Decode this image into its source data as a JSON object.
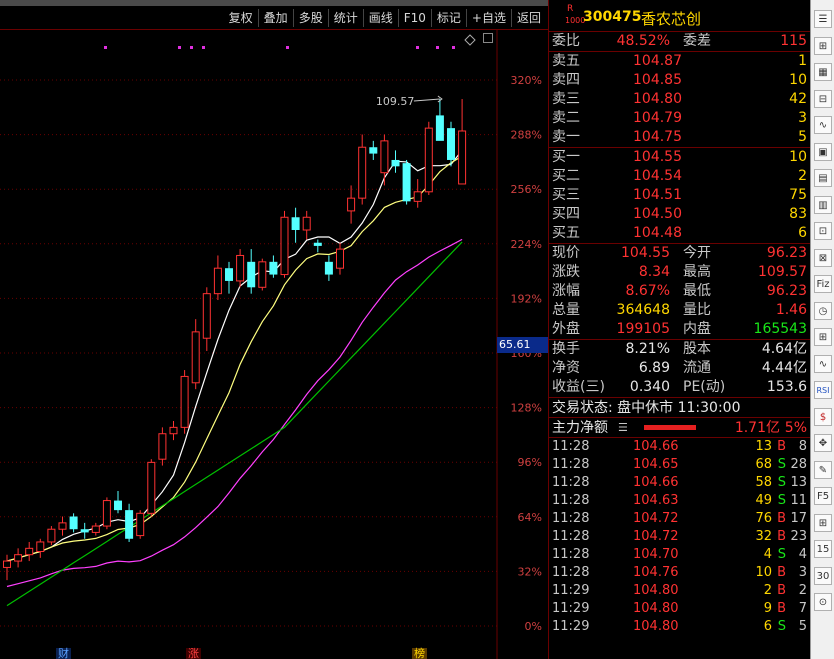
{
  "toolbar": {
    "buttons": [
      "复权",
      "叠加",
      "多股",
      "统计",
      "画线",
      "F10",
      "标记",
      "+自选",
      "返回"
    ]
  },
  "chart_data": {
    "type": "candlestick",
    "pct_axis": [
      "320%",
      "288%",
      "256%",
      "224%",
      "192%",
      "160%",
      "128%",
      "96%",
      "64%",
      "32%",
      "0%"
    ],
    "cursor_price": "65.61",
    "peak_label": "109.57",
    "bottom_marks": [
      "财",
      "涨",
      "榜"
    ],
    "candles": [
      {
        "o": 36,
        "h": 38,
        "l": 34,
        "c": 37
      },
      {
        "o": 37,
        "h": 39,
        "l": 36,
        "c": 38
      },
      {
        "o": 38,
        "h": 40,
        "l": 37,
        "c": 39
      },
      {
        "o": 38.5,
        "h": 40.5,
        "l": 37.5,
        "c": 40
      },
      {
        "o": 40,
        "h": 42.5,
        "l": 39.5,
        "c": 42
      },
      {
        "o": 42,
        "h": 44,
        "l": 41,
        "c": 43
      },
      {
        "o": 44,
        "h": 44.5,
        "l": 41.5,
        "c": 42
      },
      {
        "o": 42,
        "h": 43,
        "l": 40.5,
        "c": 41.5
      },
      {
        "o": 41.5,
        "h": 43,
        "l": 41,
        "c": 42.5
      },
      {
        "o": 42.5,
        "h": 47,
        "l": 42,
        "c": 46.5
      },
      {
        "o": 46.5,
        "h": 48,
        "l": 44.5,
        "c": 45
      },
      {
        "o": 45,
        "h": 46,
        "l": 40,
        "c": 40.5
      },
      {
        "o": 41,
        "h": 45,
        "l": 40.5,
        "c": 44.5
      },
      {
        "o": 44.5,
        "h": 53,
        "l": 44,
        "c": 52.5
      },
      {
        "o": 53,
        "h": 58,
        "l": 52,
        "c": 57
      },
      {
        "o": 57,
        "h": 59,
        "l": 56,
        "c": 58
      },
      {
        "o": 58,
        "h": 67,
        "l": 57,
        "c": 66
      },
      {
        "o": 65,
        "h": 75,
        "l": 64,
        "c": 73
      },
      {
        "o": 72,
        "h": 80,
        "l": 70,
        "c": 79
      },
      {
        "o": 79,
        "h": 85,
        "l": 78,
        "c": 83
      },
      {
        "o": 83,
        "h": 84,
        "l": 79,
        "c": 81
      },
      {
        "o": 81,
        "h": 86,
        "l": 80,
        "c": 85
      },
      {
        "o": 84,
        "h": 86,
        "l": 79,
        "c": 80
      },
      {
        "o": 80,
        "h": 84.5,
        "l": 79.5,
        "c": 84
      },
      {
        "o": 84,
        "h": 85,
        "l": 81.5,
        "c": 82
      },
      {
        "o": 82,
        "h": 92,
        "l": 81.5,
        "c": 91
      },
      {
        "o": 91,
        "h": 92.5,
        "l": 87,
        "c": 89
      },
      {
        "o": 89,
        "h": 92,
        "l": 87.5,
        "c": 91
      },
      {
        "o": 87,
        "h": 87.5,
        "l": 85.5,
        "c": 86.5
      },
      {
        "o": 84,
        "h": 85,
        "l": 81,
        "c": 82
      },
      {
        "o": 83,
        "h": 87,
        "l": 82,
        "c": 86
      },
      {
        "o": 92,
        "h": 96,
        "l": 90,
        "c": 94
      },
      {
        "o": 94,
        "h": 104,
        "l": 93,
        "c": 102
      },
      {
        "o": 102,
        "h": 103,
        "l": 100,
        "c": 101
      },
      {
        "o": 98,
        "h": 104,
        "l": 96,
        "c": 103
      },
      {
        "o": 100,
        "h": 101.5,
        "l": 98,
        "c": 99
      },
      {
        "o": 99.5,
        "h": 100,
        "l": 93,
        "c": 93.5
      },
      {
        "o": 93.5,
        "h": 97,
        "l": 92.5,
        "c": 95
      },
      {
        "o": 95,
        "h": 106,
        "l": 94.5,
        "c": 105
      },
      {
        "o": 107,
        "h": 109.57,
        "l": 104,
        "c": 103
      },
      {
        "o": 105,
        "h": 106,
        "l": 99,
        "c": 100
      },
      {
        "o": 96.23,
        "h": 109.57,
        "l": 96.23,
        "c": 104.55
      }
    ]
  },
  "quote": {
    "code": "300475",
    "name": "香农芯创",
    "badge": "R",
    "badge_sub": "1000",
    "weibi_label": "委比",
    "weibi": "48.52%",
    "weicha_label": "委差",
    "weicha": "115",
    "asks": [
      {
        "label": "卖五",
        "price": "104.87",
        "qty": "1"
      },
      {
        "label": "卖四",
        "price": "104.85",
        "qty": "10"
      },
      {
        "label": "卖三",
        "price": "104.80",
        "qty": "42"
      },
      {
        "label": "卖二",
        "price": "104.79",
        "qty": "3"
      },
      {
        "label": "卖一",
        "price": "104.75",
        "qty": "5"
      }
    ],
    "bids": [
      {
        "label": "买一",
        "price": "104.55",
        "qty": "10"
      },
      {
        "label": "买二",
        "price": "104.54",
        "qty": "2"
      },
      {
        "label": "买三",
        "price": "104.51",
        "qty": "75"
      },
      {
        "label": "买四",
        "price": "104.50",
        "qty": "83"
      },
      {
        "label": "买五",
        "price": "104.48",
        "qty": "6"
      }
    ],
    "stats": [
      {
        "l1": "现价",
        "v1": "104.55",
        "c1": "red",
        "l2": "今开",
        "v2": "96.23",
        "c2": "red"
      },
      {
        "l1": "涨跌",
        "v1": "8.34",
        "c1": "red",
        "l2": "最高",
        "v2": "109.57",
        "c2": "red"
      },
      {
        "l1": "涨幅",
        "v1": "8.67%",
        "c1": "red",
        "l2": "最低",
        "v2": "96.23",
        "c2": "red"
      },
      {
        "l1": "总量",
        "v1": "364648",
        "c1": "yel",
        "l2": "量比",
        "v2": "1.46",
        "c2": "red"
      },
      {
        "l1": "外盘",
        "v1": "199105",
        "c1": "red",
        "l2": "内盘",
        "v2": "165543",
        "c2": "grn"
      }
    ],
    "fin": [
      {
        "l1": "换手",
        "v1": "8.21%",
        "l2": "股本",
        "v2": "4.64亿"
      },
      {
        "l1": "净资",
        "v1": "6.89",
        "l2": "流通",
        "v2": "4.44亿"
      },
      {
        "l1": "收益(三)",
        "v1": "0.340",
        "l2": "PE(动)",
        "v2": "153.6"
      }
    ],
    "status": "交易状态: 盘中休市 11:30:00",
    "flow_label": "主力净额",
    "flow_value": "1.71亿",
    "flow_pct": "5%",
    "ticks": [
      {
        "t": "11:28",
        "p": "104.66",
        "v": "13",
        "d": "B",
        "n": "8"
      },
      {
        "t": "11:28",
        "p": "104.65",
        "v": "68",
        "d": "S",
        "n": "28"
      },
      {
        "t": "11:28",
        "p": "104.66",
        "v": "58",
        "d": "S",
        "n": "13"
      },
      {
        "t": "11:28",
        "p": "104.63",
        "v": "49",
        "d": "S",
        "n": "11"
      },
      {
        "t": "11:28",
        "p": "104.72",
        "v": "76",
        "d": "B",
        "n": "17"
      },
      {
        "t": "11:28",
        "p": "104.72",
        "v": "32",
        "d": "B",
        "n": "23"
      },
      {
        "t": "11:28",
        "p": "104.70",
        "v": "4",
        "d": "S",
        "n": "4"
      },
      {
        "t": "11:28",
        "p": "104.76",
        "v": "10",
        "d": "B",
        "n": "3"
      },
      {
        "t": "11:29",
        "p": "104.80",
        "v": "2",
        "d": "B",
        "n": "2"
      },
      {
        "t": "11:29",
        "p": "104.80",
        "v": "9",
        "d": "B",
        "n": "7"
      },
      {
        "t": "11:29",
        "p": "104.80",
        "v": "6",
        "d": "S",
        "n": "5"
      }
    ]
  },
  "tools": [
    "☰",
    "⊞",
    "▦",
    "⊟",
    "∿",
    "▣",
    "▤",
    "▥",
    "⊡",
    "⊠",
    "Fiz",
    "◷",
    "⊞",
    "∿",
    "RSI",
    "$",
    "✥",
    "✎",
    "F5",
    "⊞",
    "15",
    "30",
    "⊙"
  ],
  "colors": {
    "up": "#ff3232",
    "down": "#54ffff",
    "ma5": "#ffffff",
    "ma10": "#ffff80",
    "ma20": "#ff40ff",
    "ma60": "#00c000"
  }
}
